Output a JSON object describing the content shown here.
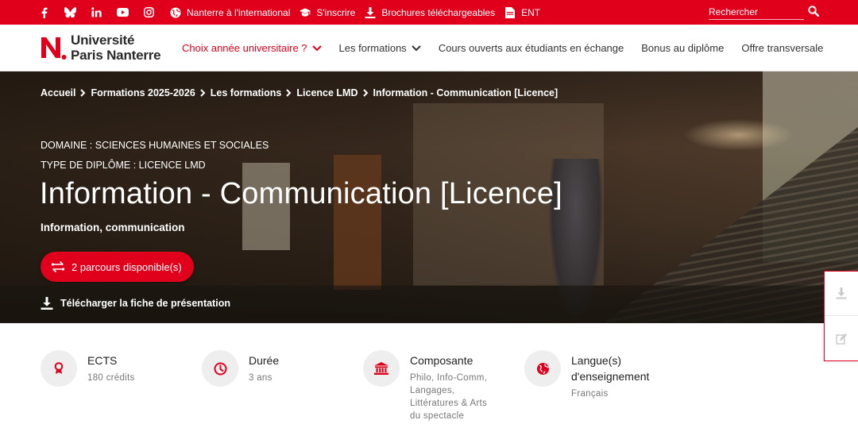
{
  "colors": {
    "brand_red": "#e0001b",
    "text_dark": "#222222",
    "muted": "#777777"
  },
  "topbar": {
    "socials": [
      {
        "name": "facebook-icon",
        "glyph": "f"
      },
      {
        "name": "bluesky-icon",
        "glyph": "butterfly"
      },
      {
        "name": "linkedin-icon",
        "glyph": "in"
      },
      {
        "name": "youtube-icon",
        "glyph": "play"
      },
      {
        "name": "instagram-icon",
        "glyph": "camera"
      }
    ],
    "links": [
      {
        "icon": "globe-icon",
        "label": "Nanterre à l'international"
      },
      {
        "icon": "graduation-cap-icon",
        "label": "S'inscrire"
      },
      {
        "icon": "download-icon",
        "label": "Brochures téléchargeables"
      },
      {
        "icon": "document-icon",
        "label": "ENT"
      }
    ],
    "search_placeholder": "Rechercher",
    "search_icon": "magnifier-icon"
  },
  "header": {
    "logo_line1": "Université",
    "logo_line2": "Paris Nanterre",
    "nav": [
      {
        "label": "Choix année universitaire ?",
        "dropdown": true,
        "active": true
      },
      {
        "label": "Les formations",
        "dropdown": true,
        "active": false
      },
      {
        "label": "Cours ouverts aux étudiants en échange",
        "dropdown": false,
        "active": false
      },
      {
        "label": "Bonus au diplôme",
        "dropdown": false,
        "active": false
      },
      {
        "label": "Offre transversale",
        "dropdown": false,
        "active": false
      }
    ]
  },
  "hero": {
    "breadcrumb": [
      "Accueil",
      "Formations 2025-2026",
      "Les formations",
      "Licence LMD",
      "Information - Communication [Licence]"
    ],
    "domain": "DOMAINE : SCIENCES HUMAINES ET SOCIALES",
    "diploma_type": "TYPE DE DIPLÔME : LICENCE LMD",
    "title": "Information - Communication [Licence]",
    "subtitle": "Information, communication",
    "parcours_button": "2 parcours disponible(s)",
    "download_link": "Télécharger la fiche de présentation"
  },
  "side_panel": [
    {
      "icon": "download-icon"
    },
    {
      "icon": "edit-icon"
    }
  ],
  "infos": [
    {
      "icon": "medal-icon",
      "title": "ECTS",
      "value": "180 crédits"
    },
    {
      "icon": "clock-icon",
      "title": "Durée",
      "value": "3 ans"
    },
    {
      "icon": "institution-icon",
      "title": "Composante",
      "value": "Philo, Info-Comm, Langages, Littératures & Arts du spectacle"
    },
    {
      "icon": "globe-icon",
      "title": "Langue(s) d'enseignement",
      "value": "Français"
    }
  ]
}
